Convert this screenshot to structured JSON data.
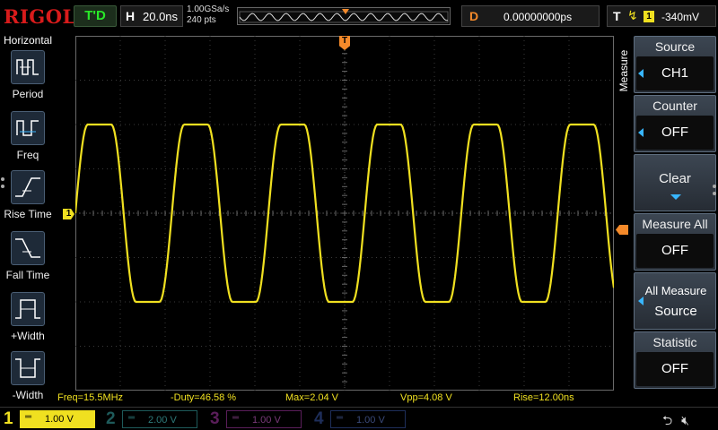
{
  "header": {
    "brand": "RIGOL",
    "run_state": "T'D",
    "timebase_label": "H",
    "timebase_value": "20.0ns",
    "sample_rate": "1.00GSa/s",
    "memory_depth": "240 pts",
    "delay_label": "D",
    "delay_value": "0.00000000ps",
    "trigger_label": "T",
    "trigger_edge": "rising",
    "trigger_source": "1",
    "trigger_level": "-340mV"
  },
  "left_menu": {
    "title": "Horizontal",
    "items": [
      {
        "label": "Period",
        "icon": "period-icon"
      },
      {
        "label": "Freq",
        "icon": "frequency-icon"
      },
      {
        "label": "Rise Time",
        "icon": "rise-time-icon"
      },
      {
        "label": "Fall Time",
        "icon": "fall-time-icon"
      },
      {
        "label": "+Width",
        "icon": "positive-width-icon"
      },
      {
        "label": "-Width",
        "icon": "negative-width-icon"
      }
    ]
  },
  "right_menu": {
    "title": "Measure",
    "source": {
      "label": "Source",
      "value": "CH1"
    },
    "counter": {
      "label": "Counter",
      "value": "OFF"
    },
    "clear": {
      "label": "Clear"
    },
    "measure_all": {
      "label": "Measure All",
      "value": "OFF"
    },
    "all_measure_source": {
      "line1": "All Measure",
      "line2": "Source"
    },
    "statistic": {
      "label": "Statistic",
      "value": "OFF"
    }
  },
  "markers": {
    "channel1": "1",
    "trigger_top": "T"
  },
  "measurements": {
    "freq": "Freq=15.5MHz",
    "duty": "-Duty=46.58 %",
    "max": "Max=2.04 V",
    "vpp": "Vpp=4.08 V",
    "rise": "Rise=12.00ns"
  },
  "channels": [
    {
      "num": "1",
      "scale": "1.00 V",
      "active": true
    },
    {
      "num": "2",
      "scale": "2.00 V",
      "active": false
    },
    {
      "num": "3",
      "scale": "1.00 V",
      "active": false
    },
    {
      "num": "4",
      "scale": "1.00 V",
      "active": false
    }
  ],
  "colors": {
    "ch1": "#f0e020",
    "trigger": "#f58a2a",
    "accent_blue": "#38b6ff"
  },
  "waveform": {
    "type": "line",
    "period_div": 2.15,
    "high_div": 2.0,
    "low_div": -2.0,
    "phase_div": 0.0,
    "rise_div": 0.55
  }
}
